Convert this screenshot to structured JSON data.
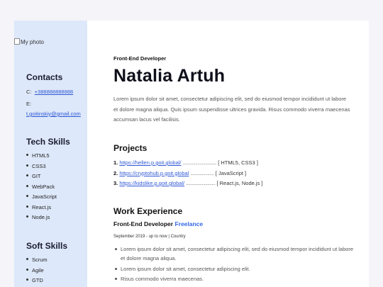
{
  "photo_alt": "My photo",
  "sidebar": {
    "contacts": {
      "title": "Contacts",
      "phone_label": "C:",
      "phone": "+388888888888",
      "email_label": "E:",
      "email": "t.goitinskiy@gmail.com"
    },
    "tech": {
      "title": "Tech Skills",
      "items": [
        "HTML5",
        "CSS3",
        "GIT",
        "WebPack",
        "JavaScript",
        "React.js",
        "Node.js"
      ]
    },
    "soft": {
      "title": "Soft Skills",
      "items": [
        "Scrum",
        "Agile",
        "GTD"
      ]
    }
  },
  "main": {
    "role": "Front-End Developer",
    "name": "Natalia Artuh",
    "about": "Lorem ipsum dolor sit amet, consectetur adipiscing elit, sed do eiusmod tempor incididunt ut labore et dolore magna aliqua. Quis ipsum suspendisse ultrices gravida. Risus commodo viverra maecenas accumsan lacus vel facilisis.",
    "projects_title": "Projects",
    "projects": [
      {
        "num": "1.",
        "url": "https://hellen.p.goit.global/",
        "dots": "..............................",
        "tech": "[ HTML5, CSS3 ]"
      },
      {
        "num": "2.",
        "url": "https://cryptohub.p.goit.global",
        "dots": ".....................",
        "tech": "[ JavaScript ]"
      },
      {
        "num": "3.",
        "url": "https://kidslike.p.goit.global/",
        "dots": "..........................",
        "tech": "[ React.js, Node.js ]"
      }
    ],
    "experience_title": "Work Experience",
    "job_title": "Front-End Developer",
    "job_company": "Freelance",
    "period": "September 2019 - up to now | Country",
    "duties": [
      "Lorem ipsum dolor sit amet, consectetur adipiscing elit, sed do eiusmod tempor incididunt ut labore et dolore magna aliqua.",
      "Lorem ipsum dolor sit amet, consectetur adipiscing elit.",
      "Risus commodo viverra maecenas."
    ]
  }
}
